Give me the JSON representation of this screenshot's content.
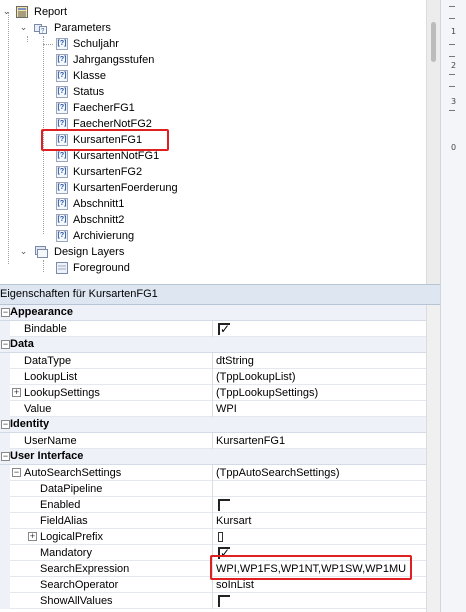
{
  "tree": {
    "nodes": [
      {
        "label": "Report",
        "icon": "report-icon",
        "expanded": true
      },
      {
        "label": "Parameters",
        "icon": "parameters-folder-icon",
        "expanded": true
      },
      {
        "label": "Schuljahr",
        "icon": "parameter-icon"
      },
      {
        "label": "Jahrgangsstufen",
        "icon": "parameter-icon"
      },
      {
        "label": "Klasse",
        "icon": "parameter-icon"
      },
      {
        "label": "Status",
        "icon": "parameter-icon"
      },
      {
        "label": "FaecherFG1",
        "icon": "parameter-icon"
      },
      {
        "label": "FaecherNotFG2",
        "icon": "parameter-icon"
      },
      {
        "label": "KursartenFG1",
        "icon": "parameter-icon",
        "selected": true
      },
      {
        "label": "KursartenNotFG1",
        "icon": "parameter-icon"
      },
      {
        "label": "KursartenFG2",
        "icon": "parameter-icon"
      },
      {
        "label": "KursartenFoerderung",
        "icon": "parameter-icon"
      },
      {
        "label": "Abschnitt1",
        "icon": "parameter-icon"
      },
      {
        "label": "Abschnitt2",
        "icon": "parameter-icon"
      },
      {
        "label": "Archivierung",
        "icon": "parameter-icon"
      },
      {
        "label": "Design Layers",
        "icon": "design-layers-icon",
        "expanded": true
      },
      {
        "label": "Foreground",
        "icon": "layer-icon"
      }
    ]
  },
  "ruler": {
    "labels": [
      "1",
      "2",
      "3",
      "0"
    ]
  },
  "properties": {
    "header": "Eigenschaften für KursartenFG1",
    "categories": [
      {
        "name": "Appearance",
        "rows": [
          {
            "name": "Bindable",
            "kind": "checkbox",
            "checked": true
          }
        ]
      },
      {
        "name": "Data",
        "rows": [
          {
            "name": "DataType",
            "value": "dtString"
          },
          {
            "name": "LookupList",
            "value": "(TppLookupList)"
          },
          {
            "name": "LookupSettings",
            "value": "(TppLookupSettings)",
            "expandable": true
          },
          {
            "name": "Value",
            "value": "WPI"
          }
        ]
      },
      {
        "name": "Identity",
        "rows": [
          {
            "name": "UserName",
            "value": "KursartenFG1"
          }
        ]
      },
      {
        "name": "User Interface",
        "rows": [
          {
            "name": "AutoSearchSettings",
            "value": "(TppAutoSearchSettings)",
            "expandable": true,
            "expanded": true
          },
          {
            "name": "DataPipeline",
            "value": "",
            "indent": 2
          },
          {
            "name": "Enabled",
            "kind": "checkbox",
            "checked": false,
            "indent": 2
          },
          {
            "name": "FieldAlias",
            "value": "Kursart",
            "indent": 2
          },
          {
            "name": "LogicalPrefix",
            "kind": "smallbox",
            "expandable": true,
            "indent": 2
          },
          {
            "name": "Mandatory",
            "kind": "checkbox",
            "checked": true,
            "indent": 2
          },
          {
            "name": "SearchExpression",
            "value": "WPI,WP1FS,WP1NT,WP1SW,WP1MU",
            "indent": 2,
            "highlighted": true
          },
          {
            "name": "SearchOperator",
            "value": "soInList",
            "indent": 2
          },
          {
            "name": "ShowAllValues",
            "kind": "checkbox",
            "checked": false,
            "indent": 2
          }
        ]
      }
    ]
  },
  "colors": {
    "highlight_border": "#e02020",
    "category_background": "#eef2f8",
    "header_background": "#dde6f1"
  }
}
